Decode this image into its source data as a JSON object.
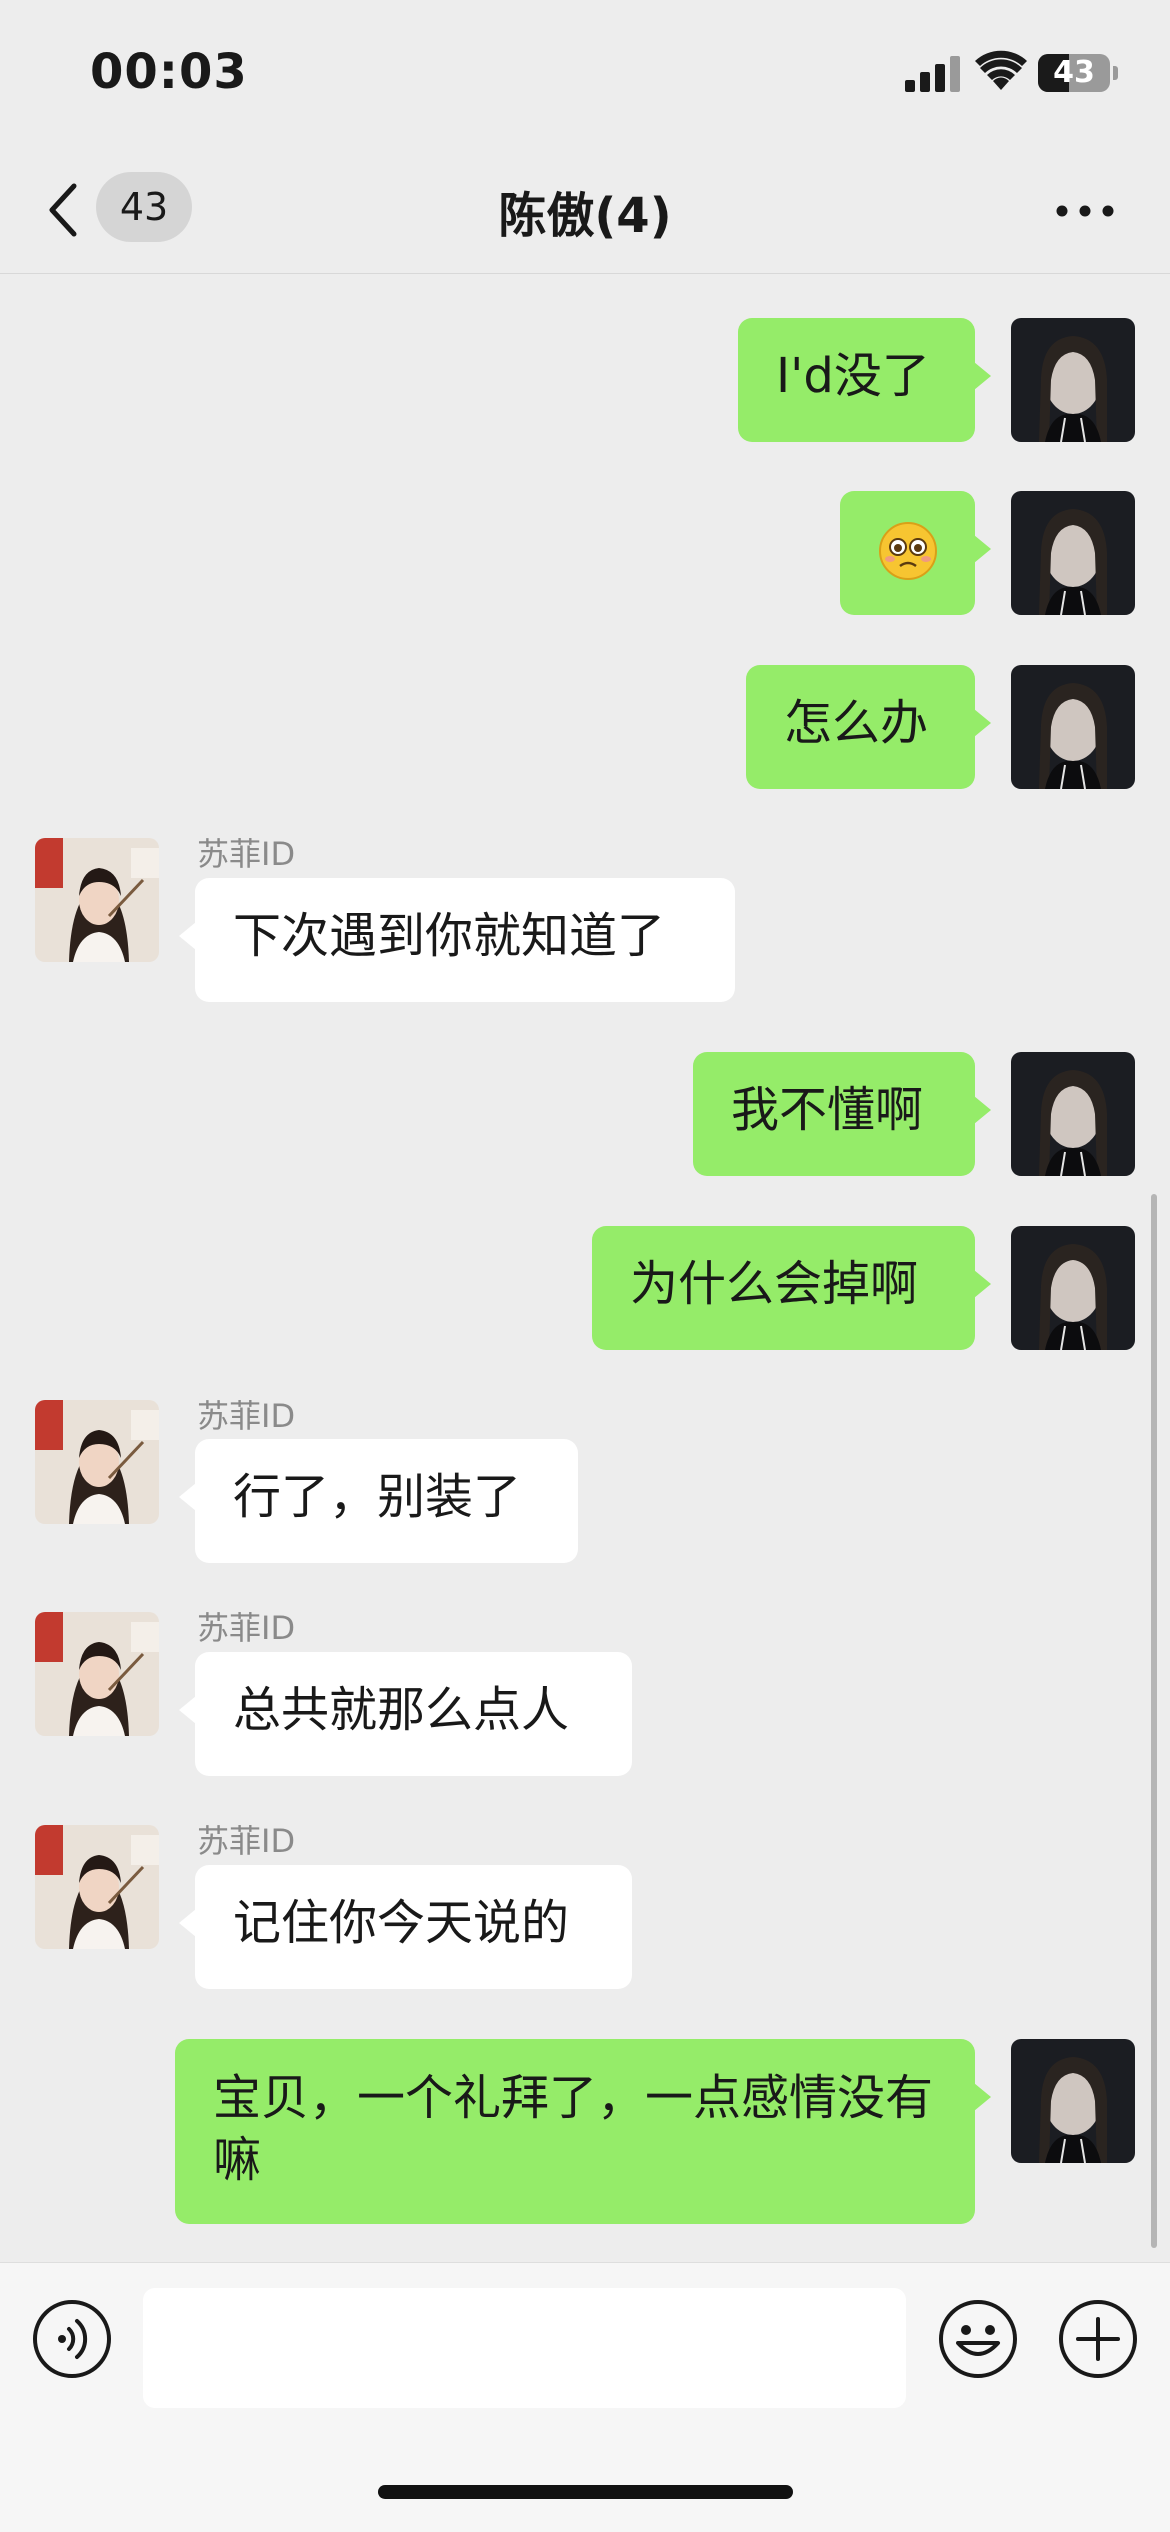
{
  "status_bar": {
    "time": "00:03",
    "battery_level": "43",
    "battery_fraction": 0.43
  },
  "nav": {
    "unread_count": "43",
    "title": "陈傲(4)"
  },
  "messages": [
    {
      "side": "me",
      "text": "I'd没了"
    },
    {
      "side": "me",
      "text": "🥺"
    },
    {
      "side": "me",
      "text": "怎么办"
    },
    {
      "side": "them",
      "sender": "苏菲ID",
      "text": "下次遇到你就知道了"
    },
    {
      "side": "me",
      "text": "我不懂啊"
    },
    {
      "side": "me",
      "text": "为什么会掉啊"
    },
    {
      "side": "them",
      "sender": "苏菲ID",
      "text": "行了，别装了"
    },
    {
      "side": "them",
      "sender": "苏菲ID",
      "text": "总共就那么点人"
    },
    {
      "side": "them",
      "sender": "苏菲ID",
      "text": "记住你今天说的"
    },
    {
      "side": "me",
      "text": "宝贝，一个礼拜了，一点感情没有嘛"
    }
  ],
  "input": {
    "value": "",
    "placeholder": ""
  },
  "icons": {
    "back": "chevron-left-icon",
    "more": "more-dots-icon",
    "voice": "voice-icon",
    "emoji": "emoji-icon",
    "plus": "plus-icon"
  },
  "colors": {
    "background": "#ededed",
    "my_bubble": "#95ec69",
    "their_bubble": "#ffffff",
    "input_bar": "#f6f6f6"
  }
}
